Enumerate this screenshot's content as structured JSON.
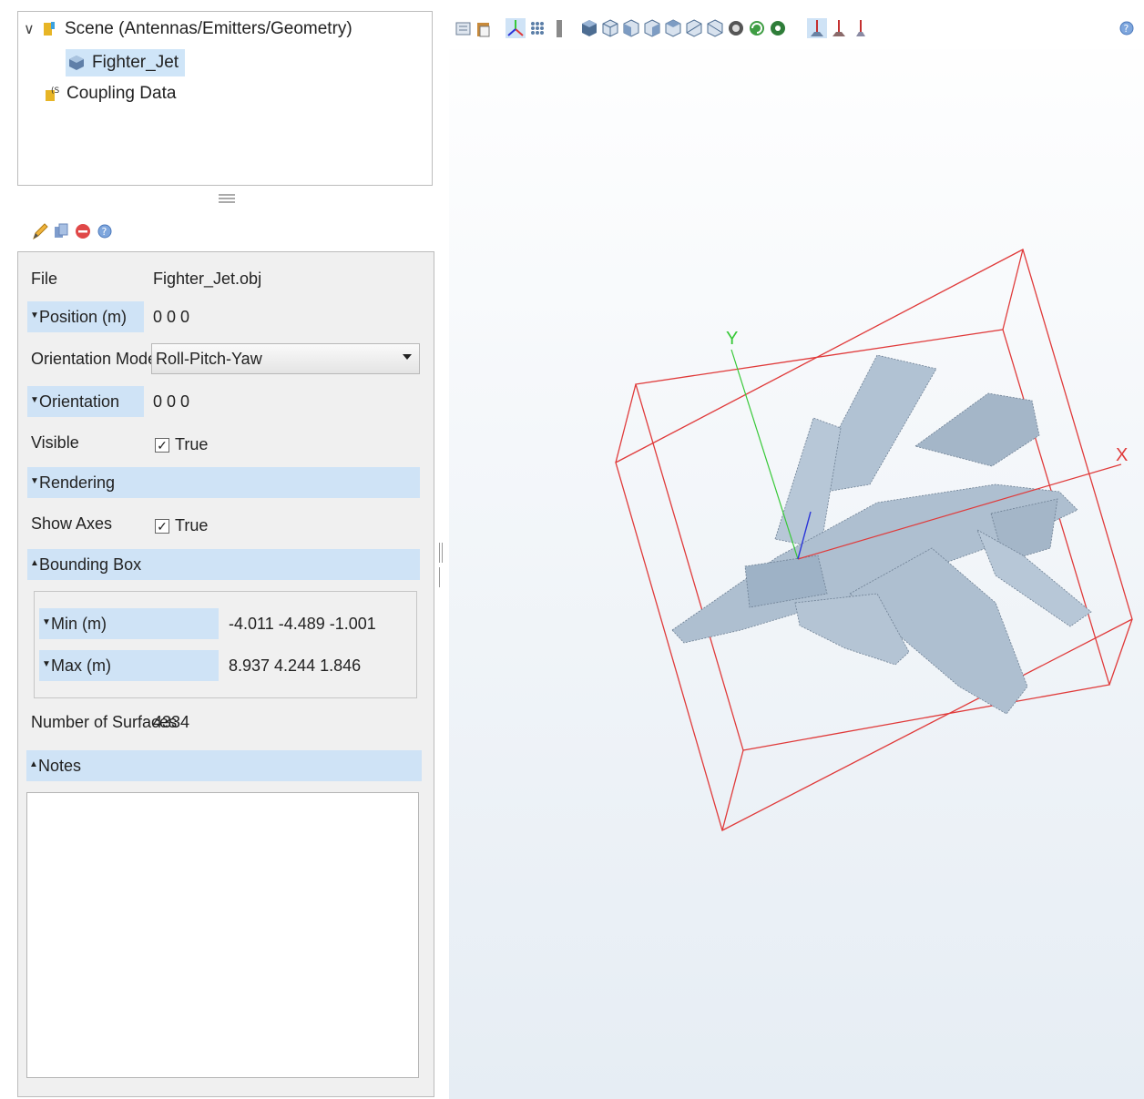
{
  "tree": {
    "root_label": "Scene (Antennas/Emitters/Geometry)",
    "child_label": "Fighter_Jet",
    "coupling_label": "Coupling Data"
  },
  "toolbar_icons": [
    "pencil-icon",
    "copy-icon",
    "delete-icon",
    "help-icon"
  ],
  "properties": {
    "file_label": "File",
    "file_value": "Fighter_Jet.obj",
    "position_label": "Position (m)",
    "position_value": "0 0 0",
    "orientation_mode_label": "Orientation Mode",
    "orientation_mode_value": "Roll-Pitch-Yaw",
    "orientation_label": "Orientation",
    "orientation_value": "0 0 0",
    "visible_label": "Visible",
    "visible_value": "True",
    "rendering_label": "Rendering",
    "show_axes_label": "Show Axes",
    "show_axes_value": "True",
    "bounding_box_label": "Bounding Box",
    "min_label": "Min (m)",
    "min_value": "-4.011 -4.489 -1.001",
    "max_label": "Max (m)",
    "max_value": "8.937 4.244 1.846",
    "surfaces_label": "Number of Surfaces",
    "surfaces_value": "4334",
    "notes_label": "Notes",
    "notes_value": ""
  },
  "viewport": {
    "axis_x_label": "X",
    "axis_y_label": "Y",
    "toolbar_icons": [
      "panel-icon",
      "clipboard-icon",
      "axes-icon",
      "grid-icon",
      "ruler-icon",
      "cube-solid-icon",
      "cube-wire-icon",
      "cube-view-icon",
      "cube-view-icon",
      "cube-view-icon",
      "cube-view-icon",
      "cube-view-icon",
      "zoom-fit-icon",
      "rotate-icon",
      "globe-icon",
      "antenna-icon",
      "antenna-icon",
      "antenna-icon",
      "help-icon"
    ],
    "bbox_color": "#e03a3a",
    "x_axis_color": "#e03a3a",
    "y_axis_color": "#37c837",
    "z_axis_color": "#2a34d8",
    "jet_color": "#aebfd0"
  }
}
